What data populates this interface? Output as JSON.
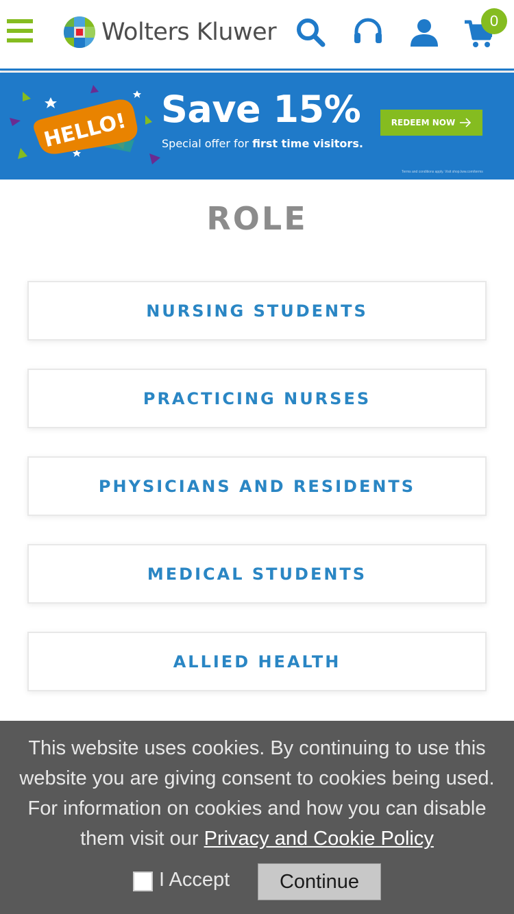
{
  "header": {
    "logo_text": "Wolters Kluwer",
    "cart_count": "0",
    "icons": [
      "menu-icon",
      "search-icon",
      "headset-icon",
      "user-icon",
      "cart-icon"
    ],
    "accent": "#85bc20",
    "brand_blue": "#1f7ac9"
  },
  "banner": {
    "badge_text": "HELLO!",
    "title": "Save 15%",
    "subtitle_prefix": "Special offer for ",
    "subtitle_bold": "first time visitors.",
    "button_label": "REDEEM NOW",
    "fine_print": "Terms and conditions apply. Visit shop.lww.com/terms"
  },
  "role": {
    "title": "ROLE",
    "items": [
      {
        "label": "NURSING STUDENTS"
      },
      {
        "label": "PRACTICING NURSES"
      },
      {
        "label": "PHYSICIANS AND RESIDENTS"
      },
      {
        "label": "MEDICAL STUDENTS"
      },
      {
        "label": "ALLIED HEALTH"
      }
    ]
  },
  "cookie": {
    "text": "This website uses cookies. By continuing to use this website you are giving consent to cookies being used. For information on cookies and how you can disable them visit our ",
    "link": "Privacy and Cookie Policy",
    "accept_label": "I Accept",
    "continue_label": "Continue"
  }
}
